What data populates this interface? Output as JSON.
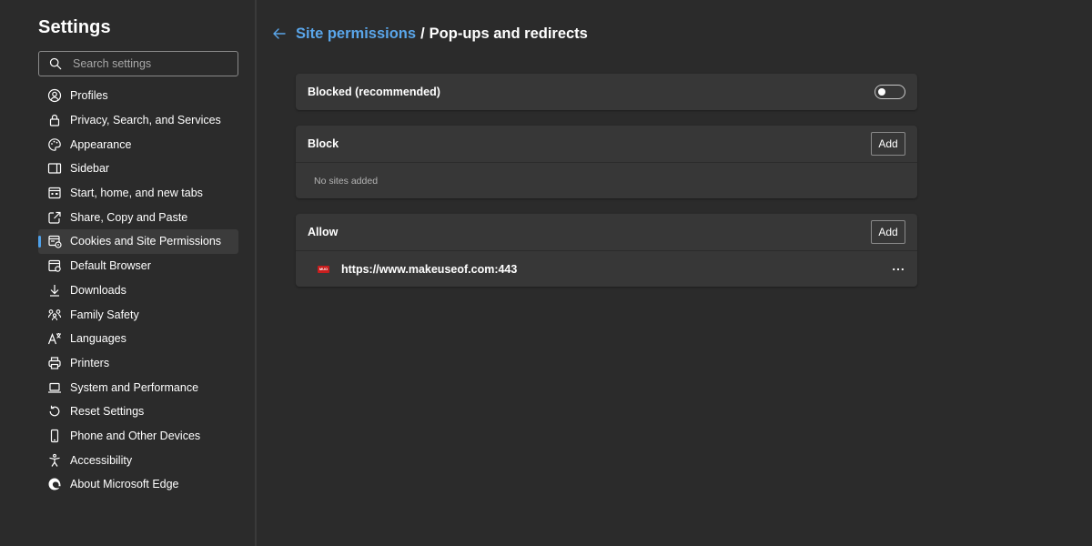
{
  "sidebar": {
    "title": "Settings",
    "search_placeholder": "Search settings",
    "items": [
      {
        "label": "Profiles",
        "icon": "profile-icon"
      },
      {
        "label": "Privacy, Search, and Services",
        "icon": "lock-icon"
      },
      {
        "label": "Appearance",
        "icon": "palette-icon"
      },
      {
        "label": "Sidebar",
        "icon": "sidebar-icon"
      },
      {
        "label": "Start, home, and new tabs",
        "icon": "home-tabs-icon"
      },
      {
        "label": "Share, Copy and Paste",
        "icon": "share-icon"
      },
      {
        "label": "Cookies and Site Permissions",
        "icon": "cookies-icon"
      },
      {
        "label": "Default Browser",
        "icon": "browser-icon"
      },
      {
        "label": "Downloads",
        "icon": "download-icon"
      },
      {
        "label": "Family Safety",
        "icon": "family-icon"
      },
      {
        "label": "Languages",
        "icon": "language-icon"
      },
      {
        "label": "Printers",
        "icon": "printer-icon"
      },
      {
        "label": "System and Performance",
        "icon": "laptop-icon"
      },
      {
        "label": "Reset Settings",
        "icon": "reset-icon"
      },
      {
        "label": "Phone and Other Devices",
        "icon": "phone-icon"
      },
      {
        "label": "Accessibility",
        "icon": "accessibility-icon"
      },
      {
        "label": "About Microsoft Edge",
        "icon": "edge-logo-icon"
      }
    ],
    "active_item": "Cookies and Site Permissions"
  },
  "header": {
    "breadcrumb_link": "Site permissions",
    "separator": "/",
    "current": "Pop-ups and redirects"
  },
  "blocked_toggle": {
    "label": "Blocked (recommended)",
    "enabled": false
  },
  "block_section": {
    "title": "Block",
    "add_label": "Add",
    "empty_text": "No sites added"
  },
  "allow_section": {
    "title": "Allow",
    "add_label": "Add",
    "sites": [
      {
        "url": "https://www.makeuseof.com:443",
        "favicon_text": "MUO",
        "more_label": "···"
      }
    ]
  },
  "colors": {
    "background": "#2b2b2b",
    "card": "#373737",
    "accent": "#5aa6ea",
    "favicon": "#c81e1e"
  }
}
